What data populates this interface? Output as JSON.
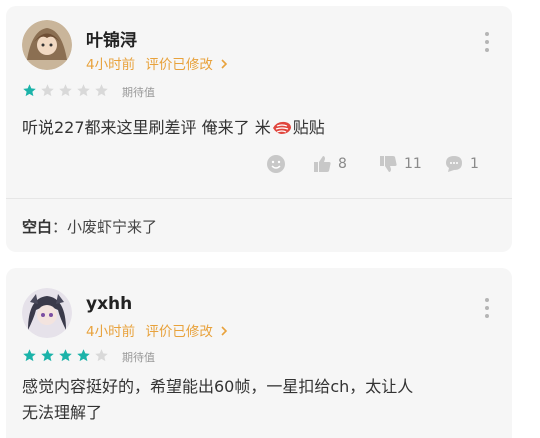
{
  "reviews": [
    {
      "username": "叶锦浔",
      "time": "4小时前",
      "edited": "评价已修改",
      "rating": 1,
      "rating_label": "期待值",
      "text_before_emoji": "听说227都来这里刷差评 俺来了 米",
      "emoji": "shrimp",
      "text_after_emoji": "贴贴",
      "likes": "8",
      "dislikes": "11",
      "comments": "1",
      "reply": {
        "author": "空白",
        "separator": "：",
        "text": "小废虾宁来了"
      }
    },
    {
      "username": "yxhh",
      "time": "4小时前",
      "edited": "评价已修改",
      "rating": 4,
      "rating_label": "期待值",
      "text_line1": "感觉内容挺好的，希望能出60帧，一星扣给ch，太让人",
      "text_line2": "无法理解了"
    }
  ],
  "colors": {
    "accent": "#e8a23c",
    "star": "#1bb3a9",
    "star_empty": "#d9d9d9"
  },
  "icons": [
    "more-vertical-icon",
    "emoji-icon",
    "thumbs-up-icon",
    "thumbs-down-icon",
    "comment-icon",
    "chevron-right-icon",
    "star-icon"
  ]
}
